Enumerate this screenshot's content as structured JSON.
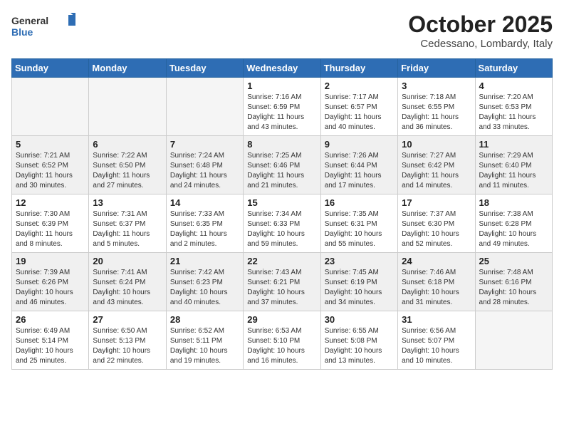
{
  "header": {
    "logo_general": "General",
    "logo_blue": "Blue",
    "month_title": "October 2025",
    "location": "Cedessano, Lombardy, Italy"
  },
  "weekdays": [
    "Sunday",
    "Monday",
    "Tuesday",
    "Wednesday",
    "Thursday",
    "Friday",
    "Saturday"
  ],
  "weeks": [
    {
      "shaded": false,
      "days": [
        {
          "num": "",
          "info": ""
        },
        {
          "num": "",
          "info": ""
        },
        {
          "num": "",
          "info": ""
        },
        {
          "num": "1",
          "info": "Sunrise: 7:16 AM\nSunset: 6:59 PM\nDaylight: 11 hours and 43 minutes."
        },
        {
          "num": "2",
          "info": "Sunrise: 7:17 AM\nSunset: 6:57 PM\nDaylight: 11 hours and 40 minutes."
        },
        {
          "num": "3",
          "info": "Sunrise: 7:18 AM\nSunset: 6:55 PM\nDaylight: 11 hours and 36 minutes."
        },
        {
          "num": "4",
          "info": "Sunrise: 7:20 AM\nSunset: 6:53 PM\nDaylight: 11 hours and 33 minutes."
        }
      ]
    },
    {
      "shaded": true,
      "days": [
        {
          "num": "5",
          "info": "Sunrise: 7:21 AM\nSunset: 6:52 PM\nDaylight: 11 hours and 30 minutes."
        },
        {
          "num": "6",
          "info": "Sunrise: 7:22 AM\nSunset: 6:50 PM\nDaylight: 11 hours and 27 minutes."
        },
        {
          "num": "7",
          "info": "Sunrise: 7:24 AM\nSunset: 6:48 PM\nDaylight: 11 hours and 24 minutes."
        },
        {
          "num": "8",
          "info": "Sunrise: 7:25 AM\nSunset: 6:46 PM\nDaylight: 11 hours and 21 minutes."
        },
        {
          "num": "9",
          "info": "Sunrise: 7:26 AM\nSunset: 6:44 PM\nDaylight: 11 hours and 17 minutes."
        },
        {
          "num": "10",
          "info": "Sunrise: 7:27 AM\nSunset: 6:42 PM\nDaylight: 11 hours and 14 minutes."
        },
        {
          "num": "11",
          "info": "Sunrise: 7:29 AM\nSunset: 6:40 PM\nDaylight: 11 hours and 11 minutes."
        }
      ]
    },
    {
      "shaded": false,
      "days": [
        {
          "num": "12",
          "info": "Sunrise: 7:30 AM\nSunset: 6:39 PM\nDaylight: 11 hours and 8 minutes."
        },
        {
          "num": "13",
          "info": "Sunrise: 7:31 AM\nSunset: 6:37 PM\nDaylight: 11 hours and 5 minutes."
        },
        {
          "num": "14",
          "info": "Sunrise: 7:33 AM\nSunset: 6:35 PM\nDaylight: 11 hours and 2 minutes."
        },
        {
          "num": "15",
          "info": "Sunrise: 7:34 AM\nSunset: 6:33 PM\nDaylight: 10 hours and 59 minutes."
        },
        {
          "num": "16",
          "info": "Sunrise: 7:35 AM\nSunset: 6:31 PM\nDaylight: 10 hours and 55 minutes."
        },
        {
          "num": "17",
          "info": "Sunrise: 7:37 AM\nSunset: 6:30 PM\nDaylight: 10 hours and 52 minutes."
        },
        {
          "num": "18",
          "info": "Sunrise: 7:38 AM\nSunset: 6:28 PM\nDaylight: 10 hours and 49 minutes."
        }
      ]
    },
    {
      "shaded": true,
      "days": [
        {
          "num": "19",
          "info": "Sunrise: 7:39 AM\nSunset: 6:26 PM\nDaylight: 10 hours and 46 minutes."
        },
        {
          "num": "20",
          "info": "Sunrise: 7:41 AM\nSunset: 6:24 PM\nDaylight: 10 hours and 43 minutes."
        },
        {
          "num": "21",
          "info": "Sunrise: 7:42 AM\nSunset: 6:23 PM\nDaylight: 10 hours and 40 minutes."
        },
        {
          "num": "22",
          "info": "Sunrise: 7:43 AM\nSunset: 6:21 PM\nDaylight: 10 hours and 37 minutes."
        },
        {
          "num": "23",
          "info": "Sunrise: 7:45 AM\nSunset: 6:19 PM\nDaylight: 10 hours and 34 minutes."
        },
        {
          "num": "24",
          "info": "Sunrise: 7:46 AM\nSunset: 6:18 PM\nDaylight: 10 hours and 31 minutes."
        },
        {
          "num": "25",
          "info": "Sunrise: 7:48 AM\nSunset: 6:16 PM\nDaylight: 10 hours and 28 minutes."
        }
      ]
    },
    {
      "shaded": false,
      "days": [
        {
          "num": "26",
          "info": "Sunrise: 6:49 AM\nSunset: 5:14 PM\nDaylight: 10 hours and 25 minutes."
        },
        {
          "num": "27",
          "info": "Sunrise: 6:50 AM\nSunset: 5:13 PM\nDaylight: 10 hours and 22 minutes."
        },
        {
          "num": "28",
          "info": "Sunrise: 6:52 AM\nSunset: 5:11 PM\nDaylight: 10 hours and 19 minutes."
        },
        {
          "num": "29",
          "info": "Sunrise: 6:53 AM\nSunset: 5:10 PM\nDaylight: 10 hours and 16 minutes."
        },
        {
          "num": "30",
          "info": "Sunrise: 6:55 AM\nSunset: 5:08 PM\nDaylight: 10 hours and 13 minutes."
        },
        {
          "num": "31",
          "info": "Sunrise: 6:56 AM\nSunset: 5:07 PM\nDaylight: 10 hours and 10 minutes."
        },
        {
          "num": "",
          "info": ""
        }
      ]
    }
  ]
}
